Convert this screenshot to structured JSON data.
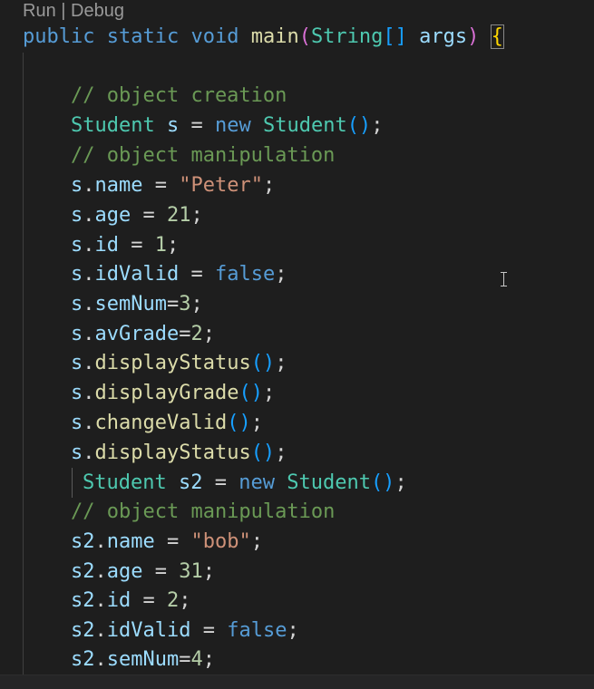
{
  "codelens": {
    "run_label": "Run",
    "separator": " | ",
    "debug_label": "Debug"
  },
  "code": {
    "l1": {
      "kw1": "public",
      "kw2": "static",
      "kw3": "void",
      "fn": "main",
      "p1": "(",
      "ty": "String",
      "arr": "[]",
      "var": "args",
      "p2": ")",
      "brace": "{"
    },
    "l3": {
      "comment": "// object creation"
    },
    "l4": {
      "ty1": "Student",
      "var": "s",
      "op": " = ",
      "kw": "new",
      "ty2": "Student",
      "paren": "()",
      "semi": ";"
    },
    "l5": {
      "comment": "// object manipulation"
    },
    "l6": {
      "obj": "s",
      "field": "name",
      "op": " = ",
      "str": "\"Peter\"",
      "semi": ";"
    },
    "l7": {
      "obj": "s",
      "field": "age",
      "op": " = ",
      "num": "21",
      "semi": ";"
    },
    "l8": {
      "obj": "s",
      "field": "id",
      "op": " = ",
      "num": "1",
      "semi": ";"
    },
    "l9": {
      "obj": "s",
      "field": "idValid",
      "op": " = ",
      "kw": "false",
      "semi": ";"
    },
    "l10": {
      "obj": "s",
      "field": "semNum",
      "op": "=",
      "num": "3",
      "semi": ";"
    },
    "l11": {
      "obj": "s",
      "field": "avGrade",
      "op": "=",
      "num": "2",
      "semi": ";"
    },
    "l12": {
      "obj": "s",
      "method": "displayStatus",
      "paren": "()",
      "semi": ";"
    },
    "l13": {
      "obj": "s",
      "method": "displayGrade",
      "paren": "()",
      "semi": ";"
    },
    "l14": {
      "obj": "s",
      "method": "changeValid",
      "paren": "()",
      "semi": ";"
    },
    "l15": {
      "obj": "s",
      "method": "displayStatus",
      "paren": "()",
      "semi": ";"
    },
    "l16": {
      "ty1": "Student",
      "var": "s2",
      "op": " = ",
      "kw": "new",
      "ty2": "Student",
      "paren": "()",
      "semi": ";"
    },
    "l17": {
      "comment": "// object manipulation"
    },
    "l18": {
      "obj": "s2",
      "field": "name",
      "op": " = ",
      "str": "\"bob\"",
      "semi": ";"
    },
    "l19": {
      "obj": "s2",
      "field": "age",
      "op": " = ",
      "num": "31",
      "semi": ";"
    },
    "l20": {
      "obj": "s2",
      "field": "id",
      "op": " = ",
      "num": "2",
      "semi": ";"
    },
    "l21": {
      "obj": "s2",
      "field": "idValid",
      "op": " = ",
      "kw": "false",
      "semi": ";"
    },
    "l22": {
      "obj": "s2",
      "field": "semNum",
      "op": "=",
      "num": "4",
      "semi": ";"
    }
  },
  "colors": {
    "background": "#1e1e1e",
    "keyword": "#569cd6",
    "function": "#dcdcaa",
    "type": "#4ec9b0",
    "variable": "#9cdcfe",
    "comment": "#6a9955",
    "string": "#ce9178",
    "number": "#b5cea8"
  },
  "icons": {
    "mouse_cursor": "text-ibeam-cursor-icon"
  }
}
